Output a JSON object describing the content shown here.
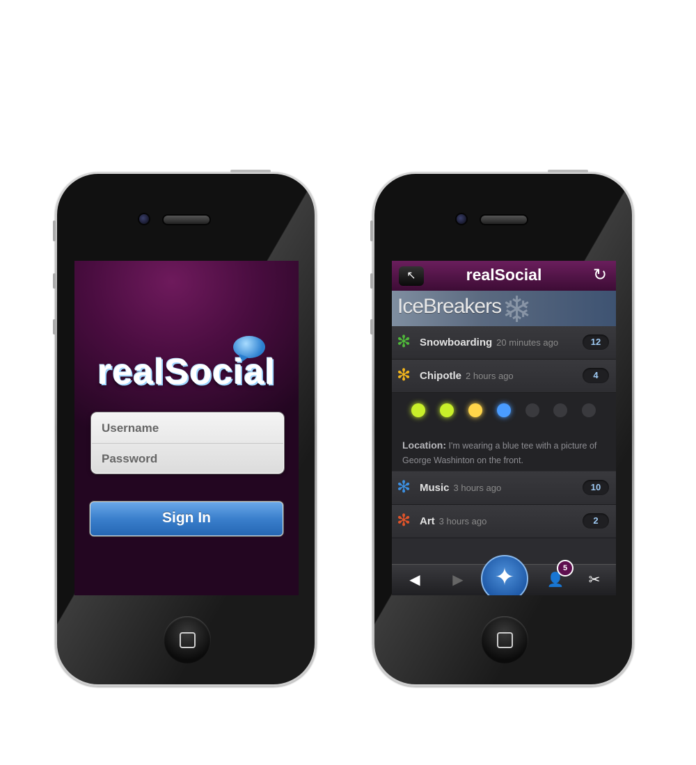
{
  "login_screen": {
    "logo_text": "realSocial",
    "username_placeholder": "Username",
    "password_placeholder": "Password",
    "signin_label": "Sign In"
  },
  "ice_screen": {
    "app_title": "realSocial",
    "back_icon": "↖",
    "refresh_icon": "↻",
    "banner_title": "IceBreakers",
    "topics": [
      {
        "name": "Snowboarding",
        "time": "20 minutes ago",
        "count": "12",
        "color": "#4fb83a"
      },
      {
        "name": "Chipotle",
        "time": "2 hours ago",
        "count": "4",
        "color": "#f2b51c"
      },
      {
        "name": "Music",
        "time": "3 hours ago",
        "count": "10",
        "color": "#3c8fe0"
      },
      {
        "name": "Art",
        "time": "3 hours ago",
        "count": "2",
        "color": "#e0542a"
      }
    ],
    "detail": {
      "location_label": "Location:",
      "location_text": "I'm wearing a blue tee with a picture of George Washinton on the front.",
      "dot_colors": [
        "#c8ef2a",
        "#c8ef2a",
        "#ffd54a",
        "#4a9cff",
        "#3a3a3e",
        "#3a3a3e",
        "#3a3a3e"
      ]
    },
    "tabbar": {
      "back_icon": "◀",
      "forward_icon": "▶",
      "compass_icon": "✦",
      "profile_icon": "👤",
      "badge_count": "5",
      "settings_icon": "✂"
    }
  }
}
